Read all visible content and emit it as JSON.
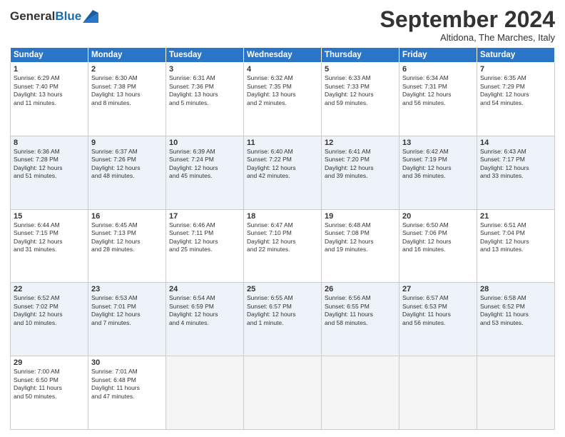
{
  "header": {
    "logo_line1": "General",
    "logo_line2": "Blue",
    "month_title": "September 2024",
    "location": "Altidona, The Marches, Italy"
  },
  "weekdays": [
    "Sunday",
    "Monday",
    "Tuesday",
    "Wednesday",
    "Thursday",
    "Friday",
    "Saturday"
  ],
  "weeks": [
    [
      {
        "day": "1",
        "info": "Sunrise: 6:29 AM\nSunset: 7:40 PM\nDaylight: 13 hours\nand 11 minutes."
      },
      {
        "day": "2",
        "info": "Sunrise: 6:30 AM\nSunset: 7:38 PM\nDaylight: 13 hours\nand 8 minutes."
      },
      {
        "day": "3",
        "info": "Sunrise: 6:31 AM\nSunset: 7:36 PM\nDaylight: 13 hours\nand 5 minutes."
      },
      {
        "day": "4",
        "info": "Sunrise: 6:32 AM\nSunset: 7:35 PM\nDaylight: 13 hours\nand 2 minutes."
      },
      {
        "day": "5",
        "info": "Sunrise: 6:33 AM\nSunset: 7:33 PM\nDaylight: 12 hours\nand 59 minutes."
      },
      {
        "day": "6",
        "info": "Sunrise: 6:34 AM\nSunset: 7:31 PM\nDaylight: 12 hours\nand 56 minutes."
      },
      {
        "day": "7",
        "info": "Sunrise: 6:35 AM\nSunset: 7:29 PM\nDaylight: 12 hours\nand 54 minutes."
      }
    ],
    [
      {
        "day": "8",
        "info": "Sunrise: 6:36 AM\nSunset: 7:28 PM\nDaylight: 12 hours\nand 51 minutes."
      },
      {
        "day": "9",
        "info": "Sunrise: 6:37 AM\nSunset: 7:26 PM\nDaylight: 12 hours\nand 48 minutes."
      },
      {
        "day": "10",
        "info": "Sunrise: 6:39 AM\nSunset: 7:24 PM\nDaylight: 12 hours\nand 45 minutes."
      },
      {
        "day": "11",
        "info": "Sunrise: 6:40 AM\nSunset: 7:22 PM\nDaylight: 12 hours\nand 42 minutes."
      },
      {
        "day": "12",
        "info": "Sunrise: 6:41 AM\nSunset: 7:20 PM\nDaylight: 12 hours\nand 39 minutes."
      },
      {
        "day": "13",
        "info": "Sunrise: 6:42 AM\nSunset: 7:19 PM\nDaylight: 12 hours\nand 36 minutes."
      },
      {
        "day": "14",
        "info": "Sunrise: 6:43 AM\nSunset: 7:17 PM\nDaylight: 12 hours\nand 33 minutes."
      }
    ],
    [
      {
        "day": "15",
        "info": "Sunrise: 6:44 AM\nSunset: 7:15 PM\nDaylight: 12 hours\nand 31 minutes."
      },
      {
        "day": "16",
        "info": "Sunrise: 6:45 AM\nSunset: 7:13 PM\nDaylight: 12 hours\nand 28 minutes."
      },
      {
        "day": "17",
        "info": "Sunrise: 6:46 AM\nSunset: 7:11 PM\nDaylight: 12 hours\nand 25 minutes."
      },
      {
        "day": "18",
        "info": "Sunrise: 6:47 AM\nSunset: 7:10 PM\nDaylight: 12 hours\nand 22 minutes."
      },
      {
        "day": "19",
        "info": "Sunrise: 6:48 AM\nSunset: 7:08 PM\nDaylight: 12 hours\nand 19 minutes."
      },
      {
        "day": "20",
        "info": "Sunrise: 6:50 AM\nSunset: 7:06 PM\nDaylight: 12 hours\nand 16 minutes."
      },
      {
        "day": "21",
        "info": "Sunrise: 6:51 AM\nSunset: 7:04 PM\nDaylight: 12 hours\nand 13 minutes."
      }
    ],
    [
      {
        "day": "22",
        "info": "Sunrise: 6:52 AM\nSunset: 7:02 PM\nDaylight: 12 hours\nand 10 minutes."
      },
      {
        "day": "23",
        "info": "Sunrise: 6:53 AM\nSunset: 7:01 PM\nDaylight: 12 hours\nand 7 minutes."
      },
      {
        "day": "24",
        "info": "Sunrise: 6:54 AM\nSunset: 6:59 PM\nDaylight: 12 hours\nand 4 minutes."
      },
      {
        "day": "25",
        "info": "Sunrise: 6:55 AM\nSunset: 6:57 PM\nDaylight: 12 hours\nand 1 minute."
      },
      {
        "day": "26",
        "info": "Sunrise: 6:56 AM\nSunset: 6:55 PM\nDaylight: 11 hours\nand 58 minutes."
      },
      {
        "day": "27",
        "info": "Sunrise: 6:57 AM\nSunset: 6:53 PM\nDaylight: 11 hours\nand 56 minutes."
      },
      {
        "day": "28",
        "info": "Sunrise: 6:58 AM\nSunset: 6:52 PM\nDaylight: 11 hours\nand 53 minutes."
      }
    ],
    [
      {
        "day": "29",
        "info": "Sunrise: 7:00 AM\nSunset: 6:50 PM\nDaylight: 11 hours\nand 50 minutes."
      },
      {
        "day": "30",
        "info": "Sunrise: 7:01 AM\nSunset: 6:48 PM\nDaylight: 11 hours\nand 47 minutes."
      },
      {
        "day": "",
        "info": ""
      },
      {
        "day": "",
        "info": ""
      },
      {
        "day": "",
        "info": ""
      },
      {
        "day": "",
        "info": ""
      },
      {
        "day": "",
        "info": ""
      }
    ]
  ]
}
